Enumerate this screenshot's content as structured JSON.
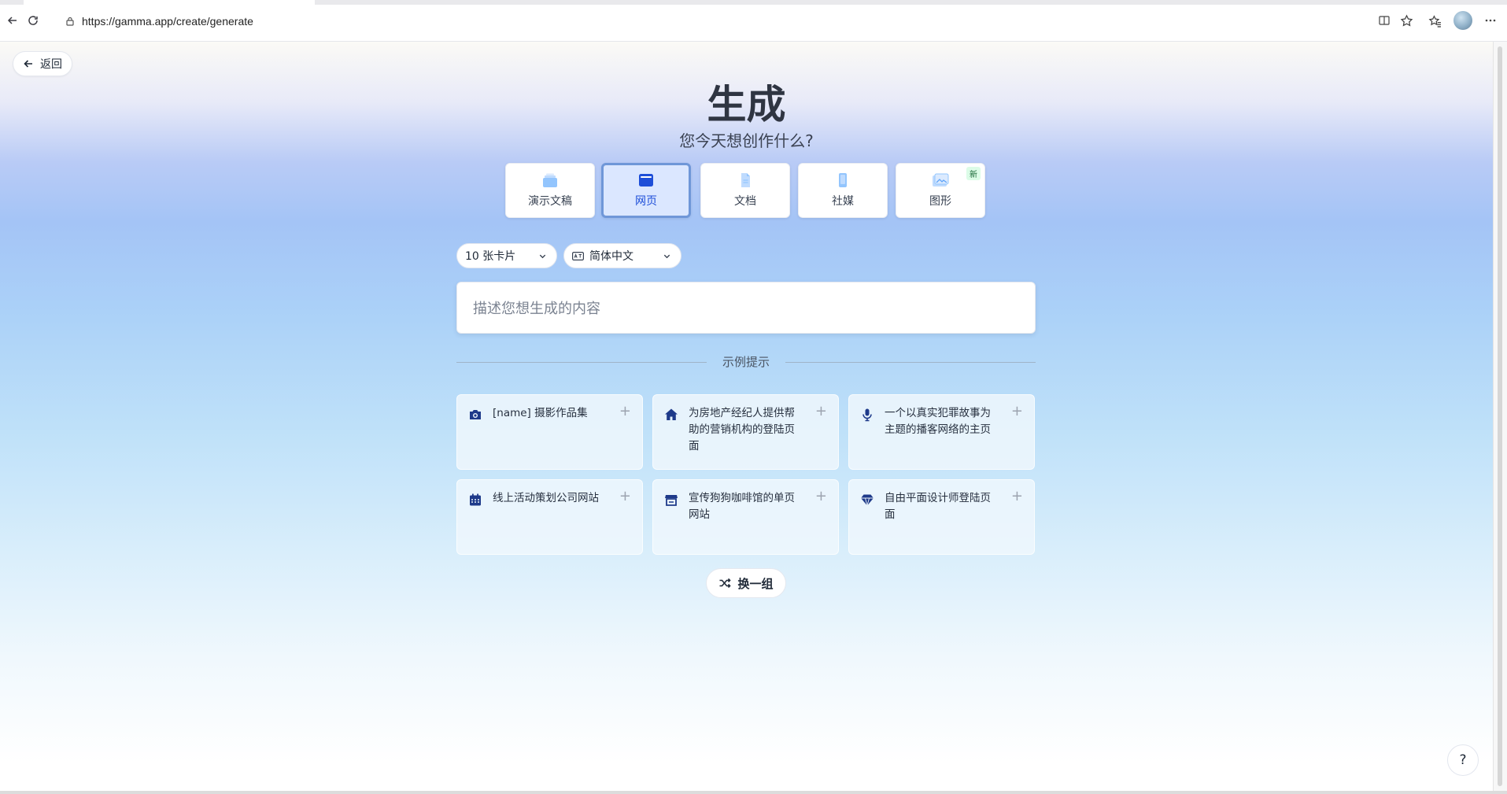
{
  "browser": {
    "url": "https://gamma.app/create/generate",
    "icons": [
      "back-arrow-icon",
      "reload-icon",
      "lock-icon",
      "split-screen-icon",
      "star-icon",
      "favorites-icon",
      "profile-avatar",
      "more-icon"
    ]
  },
  "page": {
    "back_label": "返回",
    "title": "生成",
    "subtitle": "您今天想创作什么?",
    "types": [
      {
        "label": "演示文稿",
        "icon": "presentation-icon",
        "active": false
      },
      {
        "label": "网页",
        "icon": "webpage-icon",
        "active": true
      },
      {
        "label": "文档",
        "icon": "document-icon",
        "active": false
      },
      {
        "label": "社媒",
        "icon": "social-phone-icon",
        "active": false
      },
      {
        "label": "图形",
        "icon": "graphic-image-icon",
        "active": false,
        "badge": "新"
      }
    ],
    "card_count": "10 张卡片",
    "language": "简体中文",
    "prompt_placeholder": "描述您想生成的内容",
    "examples_title": "示例提示",
    "examples": [
      {
        "icon": "camera-icon",
        "text": "[name] 摄影作品集"
      },
      {
        "icon": "home-icon",
        "text": "为房地产经纪人提供帮助的营销机构的登陆页面"
      },
      {
        "icon": "microphone-icon",
        "text": "一个以真实犯罪故事为主题的播客网络的主页"
      },
      {
        "icon": "calendar-icon",
        "text": "线上活动策划公司网站"
      },
      {
        "icon": "store-icon",
        "text": "宣传狗狗咖啡馆的单页网站"
      },
      {
        "icon": "gem-icon",
        "text": "自由平面设计师登陆页面"
      }
    ],
    "shuffle_label": "换一组",
    "help_label": "?"
  },
  "colors": {
    "accent": "#1d4ed8",
    "active_card_bg": "#dbe7ff",
    "icon_navy": "#1e3a8a"
  }
}
